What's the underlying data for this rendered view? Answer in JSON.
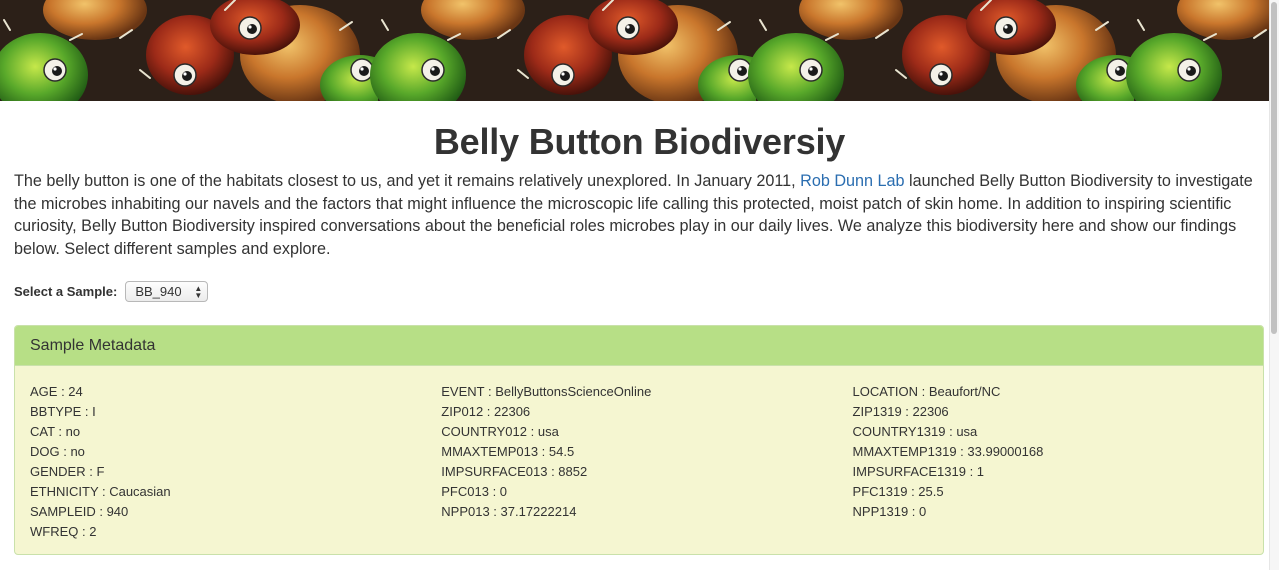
{
  "page": {
    "title": "Belly Button Biodiversiy",
    "intro_before_link": "The belly button is one of the habitats closest to us, and yet it remains relatively unexplored. In January 2011, ",
    "intro_link": "Rob Dunn Lab",
    "intro_after_link": " launched Belly Button Biodiversity to investigate the microbes inhabiting our navels and the factors that might influence the microscopic life calling this protected, moist patch of skin home. In addition to inspiring scientific curiosity, Belly Button Biodiversity inspired conversations about the beneficial roles microbes play in our daily lives. We analyze this biodiversity here and show our findings below. Select different samples and explore."
  },
  "select": {
    "label": "Select a Sample:",
    "value": "BB_940"
  },
  "panel": {
    "heading": "Sample Metadata",
    "col1": [
      "AGE : 24",
      "BBTYPE : I",
      "CAT : no",
      "DOG : no",
      "GENDER : F",
      "ETHNICITY : Caucasian",
      "SAMPLEID : 940",
      "WFREQ : 2"
    ],
    "col2": [
      "EVENT : BellyButtonsScienceOnline",
      "ZIP012 : 22306",
      "COUNTRY012 : usa",
      "MMAXTEMP013 : 54.5",
      "IMPSURFACE013 : 8852",
      "PFC013 : 0",
      "NPP013 : 37.17222214"
    ],
    "col3": [
      "LOCATION : Beaufort/NC",
      "ZIP1319 : 22306",
      "COUNTRY1319 : usa",
      "MMAXTEMP1319 : 33.99000168",
      "IMPSURFACE1319 : 1",
      "PFC1319 : 25.5",
      "NPP1319 : 0"
    ]
  },
  "colors": {
    "link": "#2a6db0",
    "panel_heading": "#b7df86",
    "panel_body": "#f5f6d1"
  }
}
